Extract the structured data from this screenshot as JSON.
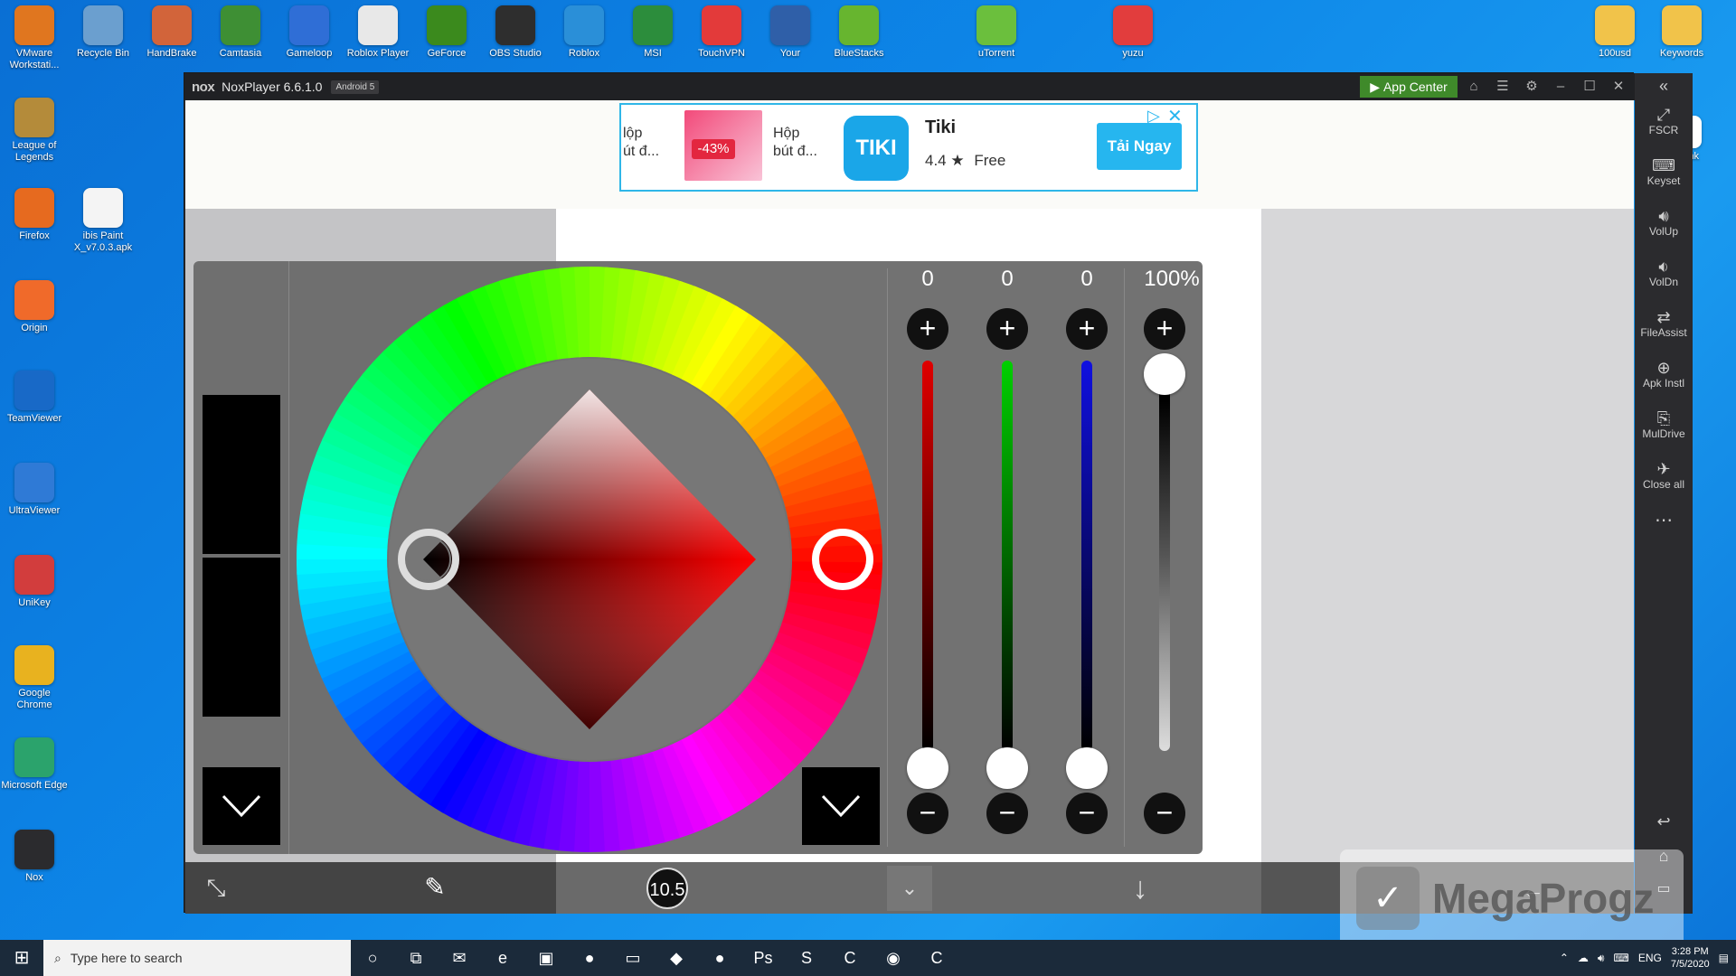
{
  "desktop": {
    "top_icons": [
      {
        "label": "VMware Workstati...",
        "icon": "vmware-icon",
        "color": "#e0761f"
      },
      {
        "label": "Recycle Bin",
        "icon": "recycle-bin-icon",
        "color": "#6b9fcf"
      },
      {
        "label": "HandBrake",
        "icon": "handbrake-icon",
        "color": "#d2643a"
      },
      {
        "label": "Camtasia",
        "icon": "camtasia-icon",
        "color": "#3e8f34"
      },
      {
        "label": "Gameloop",
        "icon": "gameloop-icon",
        "color": "#2f6ed6"
      },
      {
        "label": "Roblox Player",
        "icon": "roblox-icon",
        "color": "#e8e8e8"
      },
      {
        "label": "GeForce",
        "icon": "geforce-icon",
        "color": "#3b8a1d"
      },
      {
        "label": "OBS Studio",
        "icon": "obs-icon",
        "color": "#2e2e2e"
      },
      {
        "label": "Roblox",
        "icon": "roblox-studio-icon",
        "color": "#2a8fd8"
      },
      {
        "label": "MSI",
        "icon": "msi-icon",
        "color": "#2c8d3c"
      },
      {
        "label": "TouchVPN",
        "icon": "touchvpn-icon",
        "color": "#e33a3a"
      },
      {
        "label": "Your",
        "icon": "your-app-icon",
        "color": "#2f5fa8"
      },
      {
        "label": "BlueStacks",
        "icon": "bluestacks-icon",
        "color": "#67b52f"
      },
      {
        "label": "uTorrent",
        "icon": "utorrent-icon",
        "color": "#6bbf3d"
      },
      {
        "label": "yuzu",
        "icon": "yuzu-icon",
        "color": "#e23d3d"
      },
      {
        "label": "100usd",
        "icon": "folder-icon",
        "color": "#f1c34a"
      },
      {
        "label": "Keywords",
        "icon": "folder-icon",
        "color": "#f1c34a"
      }
    ],
    "left_icons": [
      {
        "label": "League of Legends",
        "icon": "league-icon",
        "color": "#b48b3a"
      },
      {
        "label": "Firefox",
        "icon": "firefox-icon",
        "color": "#e66a1f"
      },
      {
        "label": "ibis Paint X_v7.0.3.apk",
        "icon": "apk-file-icon",
        "color": "#f4f4f4"
      },
      {
        "label": "Origin",
        "icon": "origin-icon",
        "color": "#f06a2a"
      },
      {
        "label": "TeamViewer",
        "icon": "teamviewer-icon",
        "color": "#1869c7"
      },
      {
        "label": "UltraViewer",
        "icon": "ultraviewer-icon",
        "color": "#2f7ad6"
      },
      {
        "label": "UniKey",
        "icon": "unikey-icon",
        "color": "#d23d3d"
      },
      {
        "label": "Google Chrome",
        "icon": "chrome-icon",
        "color": "#e8b21f"
      },
      {
        "label": "Microsoft Edge",
        "icon": "edge-icon",
        "color": "#2ba36c"
      },
      {
        "label": "Nox",
        "icon": "nox-icon",
        "color": "#2b2b2e"
      }
    ],
    "partial_label": "ink"
  },
  "nox": {
    "logo": "nox",
    "title": "NoxPlayer 6.6.1.0",
    "android": "Android 5",
    "app_center": "App Center",
    "sidebar": [
      {
        "label": "FSCR",
        "icon": "fullscreen-icon"
      },
      {
        "label": "Keyset",
        "icon": "keyboard-icon"
      },
      {
        "label": "VolUp",
        "icon": "volume-up-icon"
      },
      {
        "label": "VolDn",
        "icon": "volume-down-icon"
      },
      {
        "label": "FileAssist",
        "icon": "file-assist-icon"
      },
      {
        "label": "Apk Instl",
        "icon": "apk-install-icon"
      },
      {
        "label": "MulDrive",
        "icon": "multi-drive-icon"
      },
      {
        "label": "Close all",
        "icon": "close-all-icon"
      }
    ]
  },
  "ad": {
    "left_text_1": "lộp",
    "left_text_2": "út đ...",
    "discount": "-43%",
    "product_text_1": "Hộp",
    "product_text_2": "bút đ...",
    "logo": "TIKI",
    "app_name": "Tiki",
    "rating": "4.4 ★",
    "price": "Free",
    "cta": "Tải Ngay"
  },
  "color_picker": {
    "values": {
      "r": "0",
      "g": "0",
      "b": "0",
      "alpha": "100%"
    },
    "plus": "+",
    "minus": "−",
    "accent_red": "#e00000",
    "accent_green": "#00d000",
    "accent_blue": "#1010e0"
  },
  "toolbar": {
    "brush_size": "10.5"
  },
  "watermark": "MegaProgz",
  "taskbar": {
    "search_placeholder": "Type here to search",
    "lang": "ENG",
    "time": "3:28 PM",
    "date": "7/5/2020"
  }
}
